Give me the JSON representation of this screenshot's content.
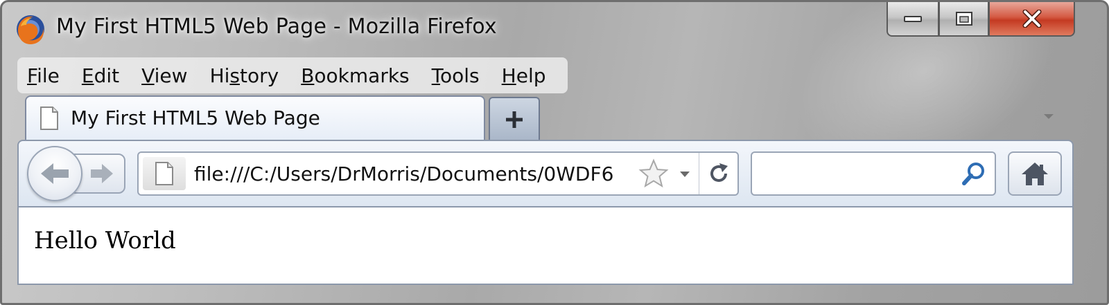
{
  "window": {
    "title": "My First HTML5 Web Page - Mozilla Firefox",
    "app_icon": "firefox-logo-icon",
    "caption_buttons": [
      "minimize-icon",
      "maximize-icon",
      "close-icon"
    ]
  },
  "menu": {
    "items": [
      {
        "label_pre": "",
        "accel": "F",
        "label_post": "ile"
      },
      {
        "label_pre": "",
        "accel": "E",
        "label_post": "dit"
      },
      {
        "label_pre": "",
        "accel": "V",
        "label_post": "iew"
      },
      {
        "label_pre": "Hi",
        "accel": "s",
        "label_post": "tory"
      },
      {
        "label_pre": "",
        "accel": "B",
        "label_post": "ookmarks"
      },
      {
        "label_pre": "",
        "accel": "T",
        "label_post": "ools"
      },
      {
        "label_pre": "",
        "accel": "H",
        "label_post": "elp"
      }
    ]
  },
  "tabs": {
    "active_label": "My First HTML5 Web Page",
    "new_tab_icon": "plus-icon"
  },
  "navigation": {
    "url": "file:///C:/Users/DrMorris/Documents/0WDF6",
    "search_value": "",
    "icons": [
      "back-arrow-icon",
      "forward-arrow-icon",
      "page-icon",
      "star-icon",
      "reload-icon",
      "search-icon",
      "home-icon"
    ]
  },
  "page": {
    "body_text": "Hello World"
  },
  "colors": {
    "chrome_gray": "#b0b0b0",
    "toolbar_blue": "#dde6f1",
    "close_red": "#c43a22",
    "search_blue": "#2e6db4"
  }
}
